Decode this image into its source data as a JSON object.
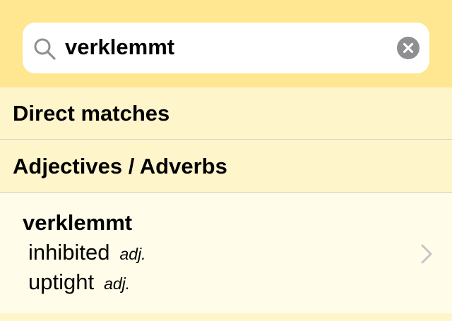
{
  "search": {
    "query": "verklemmt"
  },
  "sections": {
    "direct_matches": "Direct matches",
    "adjectives_adverbs": "Adjectives / Adverbs"
  },
  "result": {
    "headword": "verklemmt",
    "translations": [
      {
        "text": "inhibited",
        "pos": "adj."
      },
      {
        "text": "uptight",
        "pos": "adj."
      }
    ]
  },
  "colors": {
    "search_bar_bg": "#ffe791",
    "section_header_bg": "#fff5cb",
    "row_bg": "#fffde9",
    "icon_gray": "#8e8e93"
  },
  "icons": {
    "search": "search-icon",
    "clear": "clear-icon",
    "chevron": "chevron-right-icon"
  }
}
